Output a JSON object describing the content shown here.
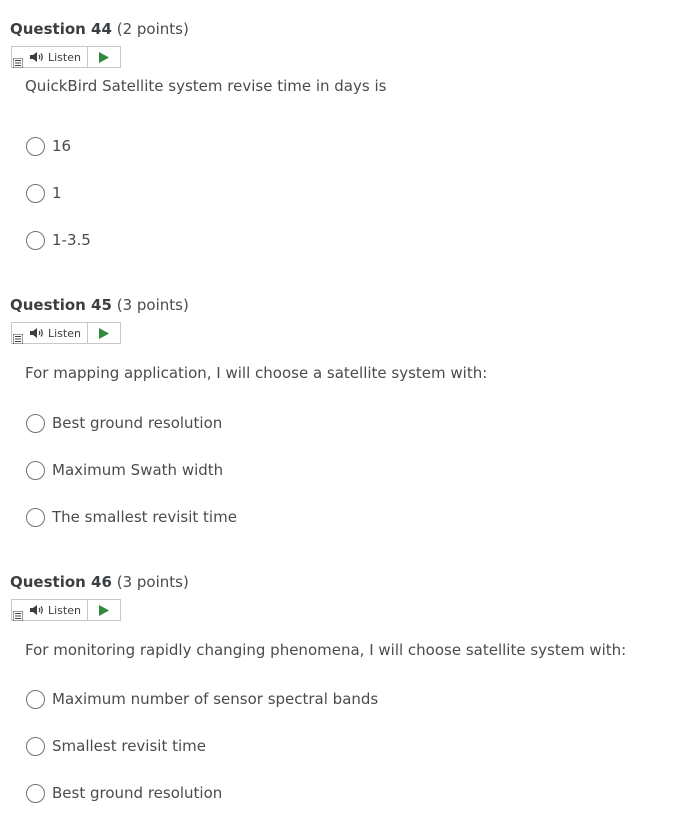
{
  "listen_label": "Listen",
  "questions": [
    {
      "title": "Question 44",
      "points": "(2 points)",
      "text": "QuickBird Satellite system revise time in days is",
      "options": [
        "16",
        "1",
        "1-3.5"
      ]
    },
    {
      "title": "Question 45",
      "points": "(3 points)",
      "text": "For mapping application, I will choose a satellite system with:",
      "options": [
        "Best ground resolution",
        "Maximum Swath width",
        "The smallest revisit time"
      ]
    },
    {
      "title": "Question 46",
      "points": "(3 points)",
      "text": "For monitoring rapidly changing phenomena, I will choose satellite system with:",
      "options": [
        "Maximum number of sensor spectral bands",
        "Smallest revisit time",
        "Best ground resolution"
      ]
    }
  ],
  "colors": {
    "play_icon": "#2e8b3c",
    "text": "#494c4e",
    "radio_border": "#6e7376"
  },
  "icons": {
    "menu": "menu-icon",
    "speaker": "speaker-icon",
    "play": "play-icon"
  }
}
